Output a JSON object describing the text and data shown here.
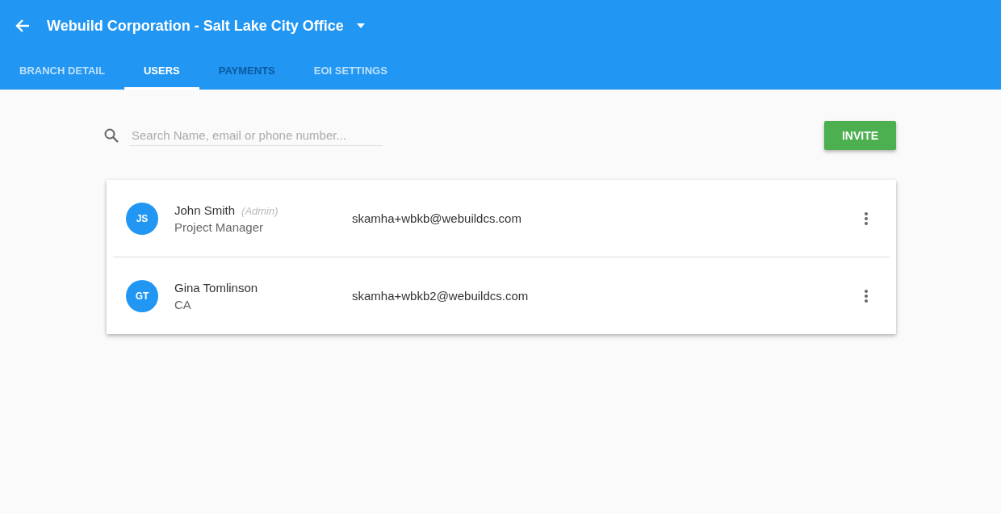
{
  "header": {
    "title": "Webuild Corporation - Salt Lake City Office"
  },
  "tabs": [
    {
      "label": "BRANCH DETAIL",
      "selected": false,
      "disabled": false
    },
    {
      "label": "USERS",
      "selected": true,
      "disabled": false
    },
    {
      "label": "PAYMENTS",
      "selected": false,
      "disabled": true
    },
    {
      "label": "EOI SETTINGS",
      "selected": false,
      "disabled": false
    }
  ],
  "search": {
    "placeholder": "Search Name, email or phone number..."
  },
  "invite_button": "INVITE",
  "users": [
    {
      "initials": "JS",
      "name": "John Smith",
      "tag": "(Admin)",
      "role": "Project Manager",
      "email": "skamha+wbkb@webuildcs.com"
    },
    {
      "initials": "GT",
      "name": "Gina Tomlinson",
      "role": "CA",
      "email": "skamha+wbkb2@webuildcs.com"
    }
  ]
}
